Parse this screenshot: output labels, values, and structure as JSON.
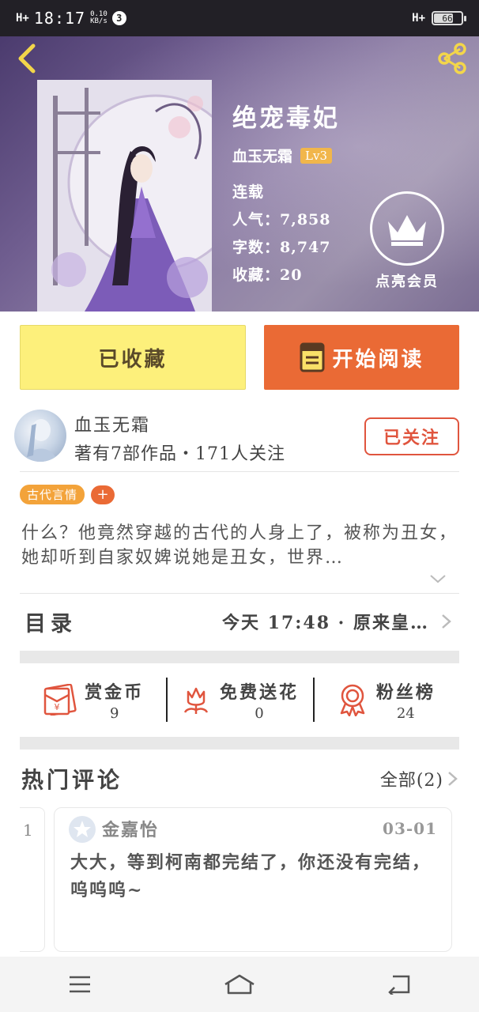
{
  "status_bar": {
    "network": "H+",
    "time": "18:17",
    "speed_value": "0.10",
    "speed_unit": "KB/s",
    "notification_count": "3",
    "network_right": "H+",
    "battery": "66"
  },
  "book": {
    "title": "绝宠毒妃",
    "author": "血玉无霜",
    "author_level": "Lv3",
    "status": "连载",
    "popularity": "人气：7,858",
    "word_count": "字数：8,747",
    "favorites": "收藏：20"
  },
  "vip": {
    "label": "点亮会员"
  },
  "actions": {
    "collected_label": "已收藏",
    "read_label": "开始阅读"
  },
  "author_card": {
    "name": "血玉无霜",
    "meta": "著有7部作品・171人关注",
    "follow_label": "已关注"
  },
  "tags": [
    "古代言情"
  ],
  "tag_add": "+",
  "synopsis": "什么？他竟然穿越的古代的人身上了，被称为丑女，她却听到自家奴婢说她是丑女，世界…",
  "catalog": {
    "title": "目录",
    "latest": "今天 17:48 · 原来皇…"
  },
  "support": [
    {
      "label": "赏金币",
      "count": "9",
      "icon": "red-envelope-icon"
    },
    {
      "label": "免费送花",
      "count": "0",
      "icon": "flower-icon"
    },
    {
      "label": "粉丝榜",
      "count": "24",
      "icon": "medal-icon"
    }
  ],
  "hot_comments": {
    "title": "热门评论",
    "all_label": "全部(2)",
    "stub_index": "1",
    "comment": {
      "user": "金嘉怡",
      "date": "03-01",
      "text": "大大，等到柯南都完结了，你还没有完结，呜呜呜~"
    }
  },
  "colors": {
    "accent_orange": "#ea6a35",
    "collected_yellow": "#fdf07b",
    "follow_red": "#e0553e",
    "tag_orange": "#f3a33a",
    "level_gold": "#f1b64b"
  }
}
